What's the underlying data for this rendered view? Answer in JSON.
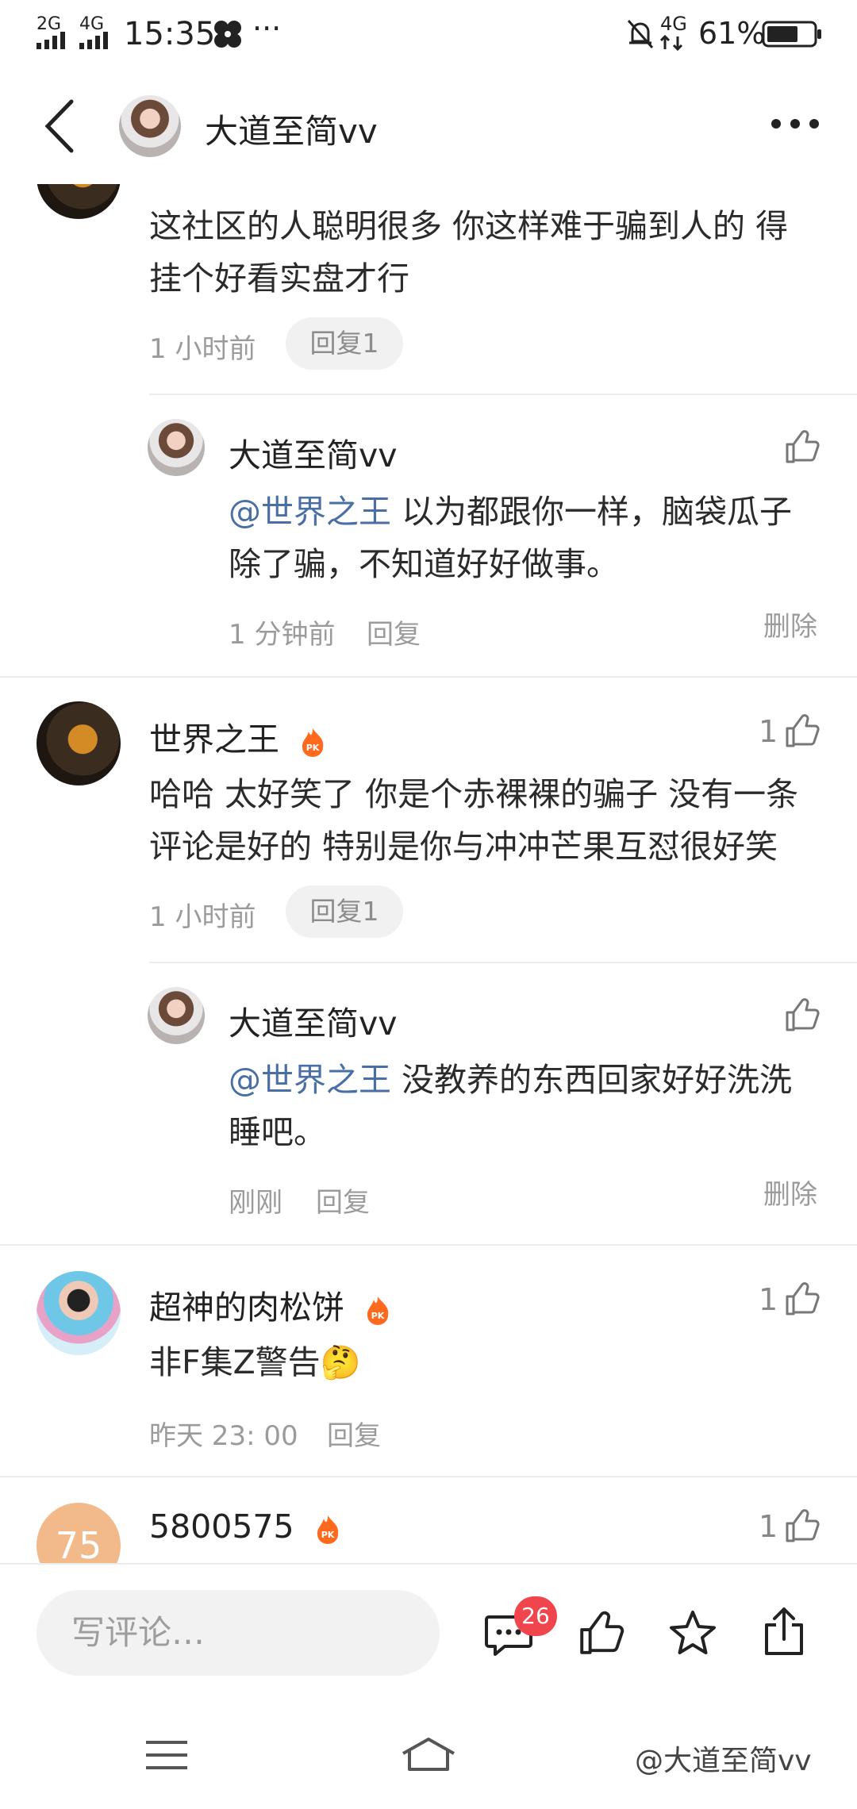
{
  "status_bar": {
    "signal1": "2G",
    "signal2": "4G",
    "time": "15:35",
    "more": "···",
    "network": "4G",
    "battery": "61%"
  },
  "header": {
    "title": "大道至简vv"
  },
  "thread1": {
    "text": "这社区的人聪明很多 你这样难于骗到人的 得挂个好看实盘才行",
    "time": "1 小时前",
    "reply_btn": "回复1",
    "reply": {
      "name": "大道至简vv",
      "mention": "@世界之王",
      "text": " 以为都跟你一样，脑袋瓜子除了骗，不知道好好做事。",
      "time": "1 分钟前",
      "reply_btn": "回复",
      "delete": "删除"
    }
  },
  "thread2": {
    "name": "世界之王",
    "likes": "1",
    "text": "哈哈 太好笑了 你是个赤裸裸的骗子 没有一条评论是好的 特别是你与冲冲芒果互怼很好笑",
    "time": "1 小时前",
    "reply_btn": "回复1",
    "reply": {
      "name": "大道至简vv",
      "mention": "@世界之王",
      "text": " 没教养的东西回家好好洗洗睡吧。",
      "time": "刚刚",
      "reply_btn": "回复",
      "delete": "删除"
    }
  },
  "thread3": {
    "name": "超神的肉松饼",
    "likes": "1",
    "text": "非F集Z警告🤔",
    "time": "昨天 23: 00",
    "reply_btn": "回复"
  },
  "thread4": {
    "avatar_text": "75",
    "name": "5800575",
    "likes": "1"
  },
  "bottom_bar": {
    "placeholder": "写评论…",
    "comment_count": "26"
  },
  "watermark": "@大道至简vv",
  "colors": {
    "mention": "#4a6fa5",
    "badge": "#f0454c",
    "pk_badge": "#ff6a1f"
  }
}
